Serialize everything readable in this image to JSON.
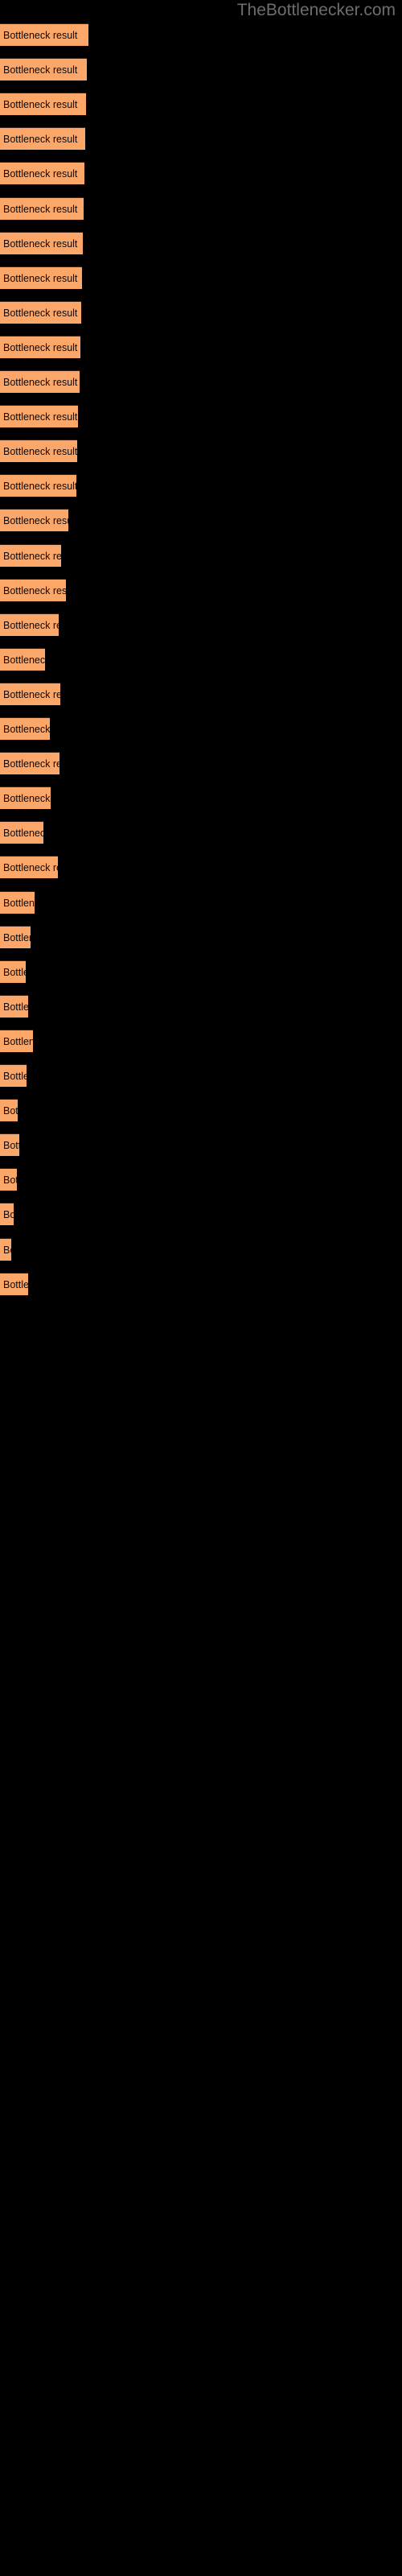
{
  "site": {
    "title": "TheBottlenecker.com",
    "title_color": "#6d6d6d",
    "background_color": "#000000"
  },
  "chart_data": {
    "type": "bar",
    "orientation": "horizontal",
    "title": "TheBottlenecker.com",
    "xlabel": "",
    "ylabel": "",
    "grid": false,
    "legend": false,
    "bar_color": "#fca76a",
    "bar_border_color": "#3a2112",
    "label_color": "#0a0a0a",
    "background": "#000000",
    "bar_label": "Bottleneck result",
    "x": [
      110,
      108,
      107,
      106,
      105,
      104,
      103,
      102,
      101,
      100,
      99,
      97,
      96,
      95,
      85,
      76,
      82,
      73,
      56,
      75,
      62,
      74,
      63,
      54,
      72,
      43,
      38,
      32,
      35,
      41,
      33,
      22,
      24,
      21,
      17,
      14,
      35
    ],
    "bars": [
      {
        "index": 1,
        "label": "Bottleneck result",
        "width": 110
      },
      {
        "index": 2,
        "label": "Bottleneck result",
        "width": 108
      },
      {
        "index": 3,
        "label": "Bottleneck result",
        "width": 107
      },
      {
        "index": 4,
        "label": "Bottleneck result",
        "width": 106
      },
      {
        "index": 5,
        "label": "Bottleneck result",
        "width": 105
      },
      {
        "index": 6,
        "label": "Bottleneck result",
        "width": 104
      },
      {
        "index": 7,
        "label": "Bottleneck result",
        "width": 103
      },
      {
        "index": 8,
        "label": "Bottleneck result",
        "width": 102
      },
      {
        "index": 9,
        "label": "Bottleneck result",
        "width": 101
      },
      {
        "index": 10,
        "label": "Bottleneck result",
        "width": 100
      },
      {
        "index": 11,
        "label": "Bottleneck result",
        "width": 99
      },
      {
        "index": 12,
        "label": "Bottleneck result",
        "width": 97
      },
      {
        "index": 13,
        "label": "Bottleneck result",
        "width": 96
      },
      {
        "index": 14,
        "label": "Bottleneck result",
        "width": 95
      },
      {
        "index": 15,
        "label": "Bottleneck result",
        "width": 85
      },
      {
        "index": 16,
        "label": "Bottleneck result",
        "width": 76
      },
      {
        "index": 17,
        "label": "Bottleneck result",
        "width": 82
      },
      {
        "index": 18,
        "label": "Bottleneck result",
        "width": 73
      },
      {
        "index": 19,
        "label": "Bottleneck result",
        "width": 56
      },
      {
        "index": 20,
        "label": "Bottleneck result",
        "width": 75
      },
      {
        "index": 21,
        "label": "Bottleneck result",
        "width": 62
      },
      {
        "index": 22,
        "label": "Bottleneck result",
        "width": 74
      },
      {
        "index": 23,
        "label": "Bottleneck result",
        "width": 63
      },
      {
        "index": 24,
        "label": "Bottleneck result",
        "width": 54
      },
      {
        "index": 25,
        "label": "Bottleneck result",
        "width": 72
      },
      {
        "index": 26,
        "label": "Bottleneck result",
        "width": 43
      },
      {
        "index": 27,
        "label": "Bottleneck result",
        "width": 38
      },
      {
        "index": 28,
        "label": "Bottleneck result",
        "width": 32
      },
      {
        "index": 29,
        "label": "Bottleneck result",
        "width": 35
      },
      {
        "index": 30,
        "label": "Bottleneck result",
        "width": 41
      },
      {
        "index": 31,
        "label": "Bottleneck result",
        "width": 33
      },
      {
        "index": 32,
        "label": "Bottleneck result",
        "width": 22
      },
      {
        "index": 33,
        "label": "Bottleneck result",
        "width": 24
      },
      {
        "index": 34,
        "label": "Bottleneck result",
        "width": 21
      },
      {
        "index": 35,
        "label": "Bottleneck result",
        "width": 17
      },
      {
        "index": 36,
        "label": "Bottleneck result",
        "width": 14
      },
      {
        "index": 37,
        "label": "Bottleneck result",
        "width": 35
      }
    ]
  }
}
